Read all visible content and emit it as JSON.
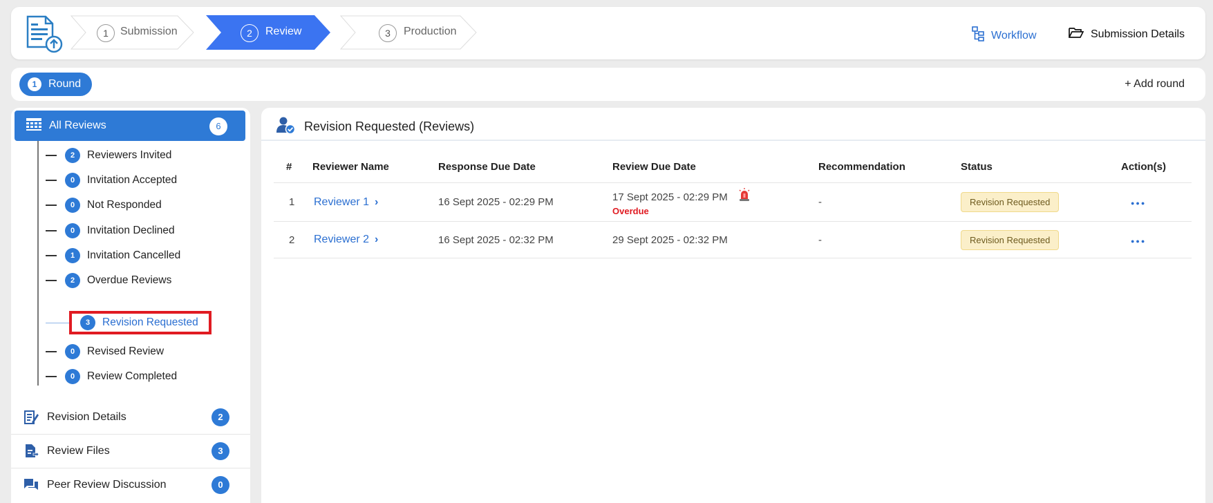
{
  "steps": [
    {
      "num": "1",
      "label": "Submission"
    },
    {
      "num": "2",
      "label": "Review"
    },
    {
      "num": "3",
      "label": "Production"
    }
  ],
  "header": {
    "workflow_label": "Workflow",
    "submission_details_label": "Submission Details"
  },
  "round": {
    "number": "1",
    "label": "Round",
    "add_label": "+ Add round"
  },
  "sidebar": {
    "all_reviews": {
      "label": "All Reviews",
      "count": "6"
    },
    "sub_items": [
      {
        "count": "2",
        "label": "Reviewers Invited"
      },
      {
        "count": "0",
        "label": "Invitation Accepted"
      },
      {
        "count": "0",
        "label": "Not Responded"
      },
      {
        "count": "0",
        "label": "Invitation Declined"
      },
      {
        "count": "1",
        "label": "Invitation Cancelled"
      },
      {
        "count": "2",
        "label": "Overdue Reviews"
      },
      {
        "count": "3",
        "label": "Revision Requested"
      },
      {
        "count": "0",
        "label": "Revised Review"
      },
      {
        "count": "0",
        "label": "Review Completed"
      }
    ],
    "sections": [
      {
        "label": "Revision Details",
        "count": "2"
      },
      {
        "label": "Review Files",
        "count": "3"
      },
      {
        "label": "Peer Review Discussion",
        "count": "0"
      }
    ]
  },
  "main": {
    "title": "Revision Requested (Reviews)",
    "columns": [
      "#",
      "Reviewer Name",
      "Response Due Date",
      "Review Due Date",
      "Recommendation",
      "Status",
      "Action(s)"
    ],
    "rows": [
      {
        "num": "1",
        "name": "Reviewer 1",
        "response_due": "16 Sept 2025 - 02:29 PM",
        "review_due": "17 Sept 2025 - 02:29 PM",
        "overdue": "Overdue",
        "recommendation": "-",
        "status": "Revision Requested",
        "action": "●●●"
      },
      {
        "num": "2",
        "name": "Reviewer 2",
        "response_due": "16 Sept 2025 - 02:32 PM",
        "review_due": "29 Sept 2025 - 02:32 PM",
        "overdue": "",
        "recommendation": "-",
        "status": "Revision Requested",
        "action": "●●●"
      }
    ]
  },
  "colors": {
    "accent": "#2e7ad6",
    "link": "#2b6fd1",
    "overdue": "#e01b22",
    "badge_bg": "#fbefc9"
  }
}
